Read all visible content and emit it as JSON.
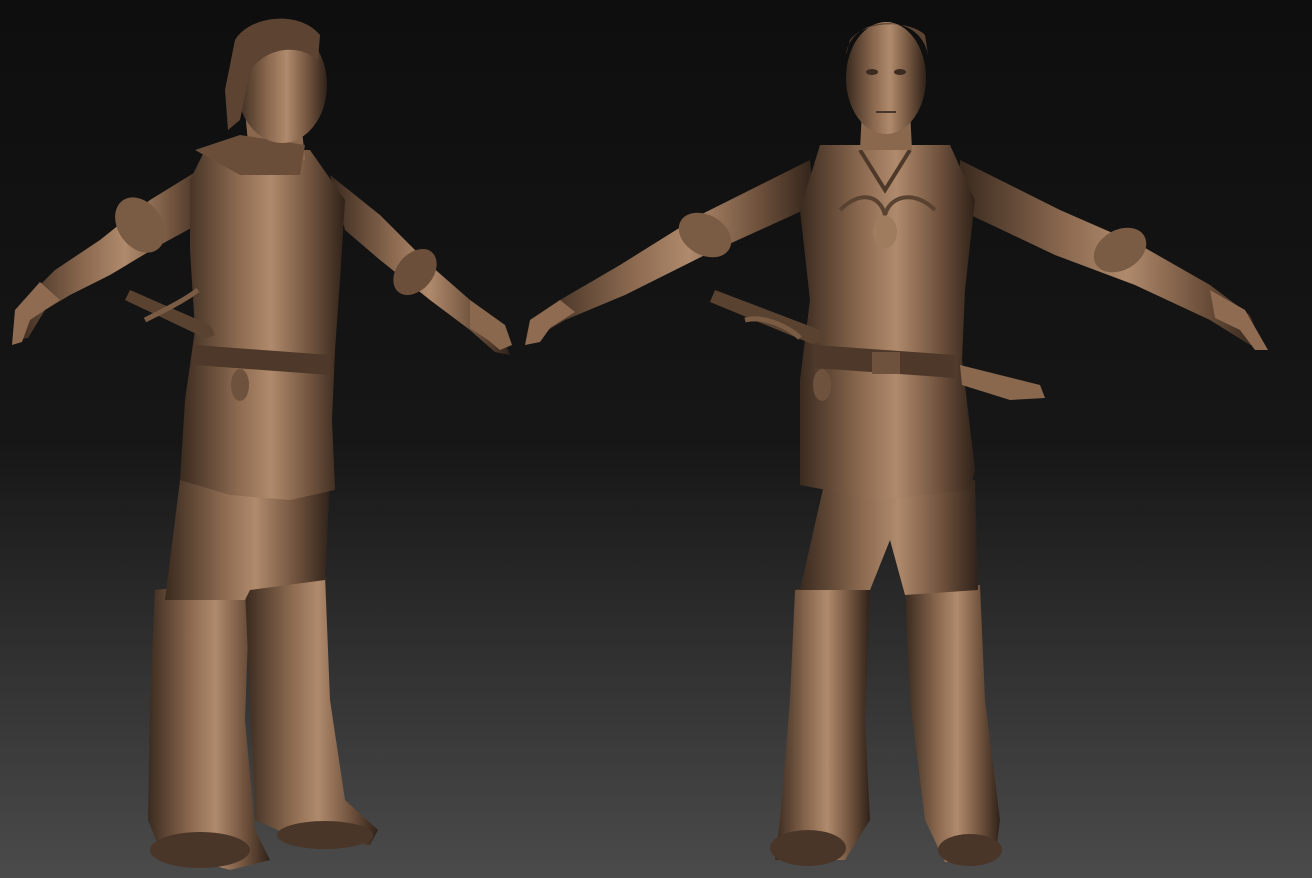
{
  "scene": {
    "background_top": "#0d0d0d",
    "background_bottom": "#4a4a4a",
    "material_base": "#7a5a42",
    "material_shadow": "#2e2118",
    "material_highlight": "#c9a488",
    "views": [
      {
        "id": "three-quarter-view",
        "label": ""
      },
      {
        "id": "front-view",
        "label": ""
      }
    ]
  }
}
